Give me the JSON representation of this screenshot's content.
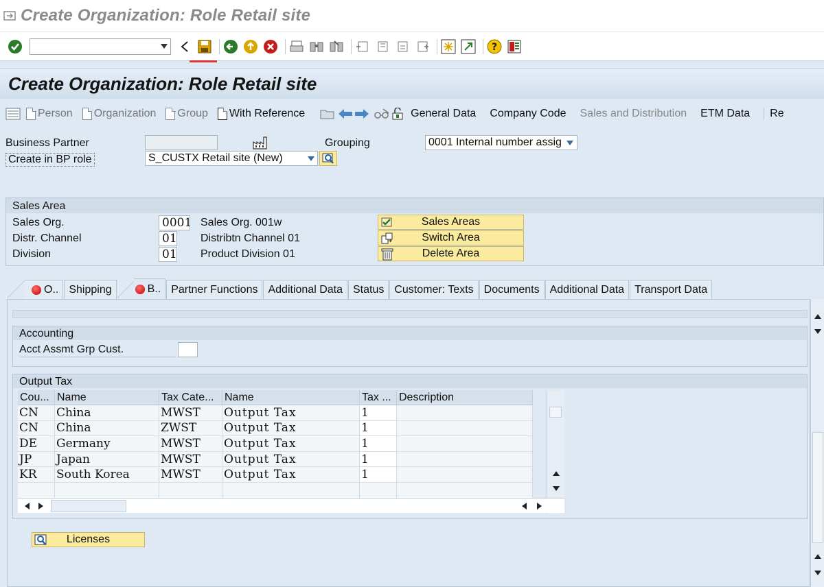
{
  "window": {
    "title": "Create Organization: Role Retail site"
  },
  "std_toolbar": {
    "command_value": ""
  },
  "app": {
    "title": "Create Organization: Role Retail site"
  },
  "app_toolbar": {
    "person": "Person",
    "organization": "Organization",
    "group": "Group",
    "with_reference": "With Reference",
    "general_data": "General Data",
    "company_code": "Company Code",
    "sales_distribution": "Sales and Distribution",
    "etm_data": "ETM Data",
    "more": "Re"
  },
  "header": {
    "business_partner_label": "Business Partner",
    "business_partner_value": "",
    "grouping_label": "Grouping",
    "grouping_value": "0001 Internal number assig",
    "bp_role_label": "Create in BP role",
    "bp_role_value": "S_CUSTX Retail site (New)"
  },
  "sales_area": {
    "title": "Sales Area",
    "rows": [
      {
        "label": "Sales Org.",
        "code": "0001",
        "desc": "Sales Org. 001w"
      },
      {
        "label": "Distr. Channel",
        "code": "01",
        "desc": "Distribtn Channel 01"
      },
      {
        "label": "Division",
        "code": "01",
        "desc": "Product Division 01"
      }
    ],
    "buttons": {
      "sales_areas": "Sales Areas",
      "switch_area": "Switch Area",
      "delete_area": "Delete Area"
    }
  },
  "tabs": [
    {
      "label": "O..",
      "error": true
    },
    {
      "label": "Shipping",
      "error": false
    },
    {
      "label": "B..",
      "error": true
    },
    {
      "label": "Partner Functions",
      "error": false
    },
    {
      "label": "Additional Data",
      "error": false
    },
    {
      "label": "Status",
      "error": false
    },
    {
      "label": "Customer: Texts",
      "error": false
    },
    {
      "label": "Documents",
      "error": false
    },
    {
      "label": "Additional Data",
      "error": false
    },
    {
      "label": "Transport Data",
      "error": false
    }
  ],
  "accounting": {
    "title": "Accounting",
    "acct_label": "Acct Assmt Grp Cust.",
    "acct_value": ""
  },
  "output_tax": {
    "title": "Output Tax",
    "columns": [
      "Cou...",
      "Name",
      "Tax Cate...",
      "Name",
      "Tax ...",
      "Description"
    ],
    "rows": [
      {
        "country": "CN",
        "name": "China",
        "cat": "MWST",
        "cat_name": "Output Tax",
        "class": "1",
        "desc": ""
      },
      {
        "country": "CN",
        "name": "China",
        "cat": "ZWST",
        "cat_name": "Output Tax",
        "class": "1",
        "desc": ""
      },
      {
        "country": "DE",
        "name": "Germany",
        "cat": "MWST",
        "cat_name": "Output Tax",
        "class": "1",
        "desc": ""
      },
      {
        "country": "JP",
        "name": "Japan",
        "cat": "MWST",
        "cat_name": "Output Tax",
        "class": "1",
        "desc": ""
      },
      {
        "country": "KR",
        "name": "South Korea",
        "cat": "MWST",
        "cat_name": "Output Tax",
        "class": "1",
        "desc": ""
      }
    ]
  },
  "licenses": {
    "label": "Licenses"
  }
}
